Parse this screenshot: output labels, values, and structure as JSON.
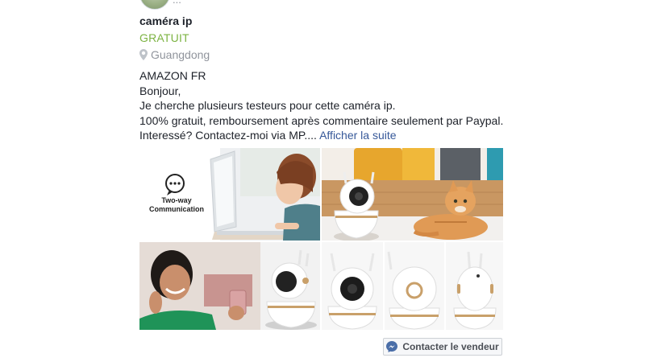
{
  "post": {
    "avatar_text": "...",
    "title": "caméra ip",
    "price": "GRATUIT",
    "location": "Guangdong"
  },
  "description": {
    "lines": [
      "AMAZON FR",
      "Bonjour,",
      "Je cherche plusieurs testeurs pour cette caméra ip.",
      "100% gratuit, remboursement après commentaire seulement par Paypal.",
      "Interessé? Contactez-moi via MP...."
    ],
    "more_link": "Afficher la suite"
  },
  "images": {
    "feature_label_line1": "Two-way",
    "feature_label_line2": "Communication"
  },
  "contact_button": {
    "label": "Contacter le vendeur"
  },
  "colors": {
    "price_green": "#7cb342",
    "link_blue": "#365899",
    "muted_gray": "#90949c",
    "messenger_blue": "#4a6ea8",
    "camera_gold": "#c9a06a"
  },
  "icons": {
    "location": "location-pin-icon",
    "messenger": "messenger-icon",
    "chat": "chat-bubble-icon"
  }
}
